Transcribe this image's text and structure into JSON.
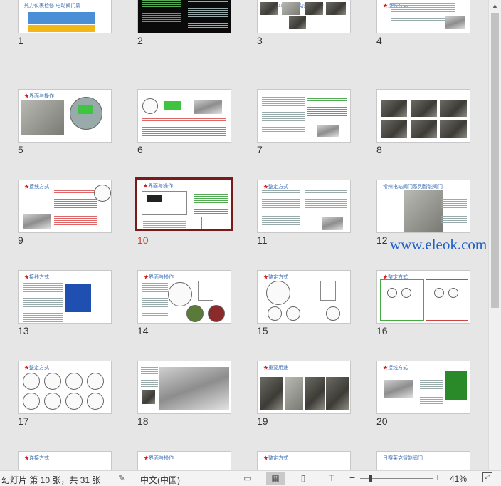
{
  "slides": [
    {
      "number": "1",
      "title": "热力仪表检修-电动阀门篇",
      "selected": false
    },
    {
      "number": "2",
      "title": "",
      "selected": false
    },
    {
      "number": "3",
      "title": "思恩ROTORK电动执行机构",
      "selected": false
    },
    {
      "number": "4",
      "title": "接线方式",
      "selected": false
    },
    {
      "number": "5",
      "title": "界面与操作",
      "selected": false
    },
    {
      "number": "6",
      "title": "",
      "selected": false
    },
    {
      "number": "7",
      "title": "",
      "selected": false
    },
    {
      "number": "8",
      "title": "",
      "selected": false
    },
    {
      "number": "9",
      "title": "接线方式",
      "selected": false
    },
    {
      "number": "10",
      "title": "界面与操作",
      "selected": true
    },
    {
      "number": "11",
      "title": "整定方式",
      "selected": false
    },
    {
      "number": "12",
      "title": "常州电站阀门系列智能阀门",
      "selected": false
    },
    {
      "number": "13",
      "title": "接线方式",
      "selected": false
    },
    {
      "number": "14",
      "title": "界面与操作",
      "selected": false
    },
    {
      "number": "15",
      "title": "整定方式",
      "selected": false
    },
    {
      "number": "16",
      "title": "整定方式",
      "selected": false
    },
    {
      "number": "17",
      "title": "整定方式",
      "selected": false
    },
    {
      "number": "18",
      "title": "",
      "selected": false
    },
    {
      "number": "19",
      "title": "重要用途",
      "selected": false
    },
    {
      "number": "20",
      "title": "接线方式",
      "selected": false
    },
    {
      "number": "",
      "title": "连接方式",
      "selected": false
    },
    {
      "number": "",
      "title": "界面与操作",
      "selected": false
    },
    {
      "number": "",
      "title": "整定方式",
      "selected": false
    },
    {
      "number": "",
      "title": "日赛莱克智能阀门",
      "selected": false
    }
  ],
  "watermark": "www.eleok.com",
  "statusbar": {
    "slide_info": "幻灯片 第 10 张，共 31 张",
    "language": "中文(中国)",
    "zoom_level": "41%",
    "zoom_fraction": 0.13
  },
  "colors": {
    "selected_border": "#7a1a1a",
    "selected_number": "#c8473a",
    "watermark": "#1e5fc4",
    "title_blue": "#3c6fb4",
    "star_red": "#d02020"
  }
}
